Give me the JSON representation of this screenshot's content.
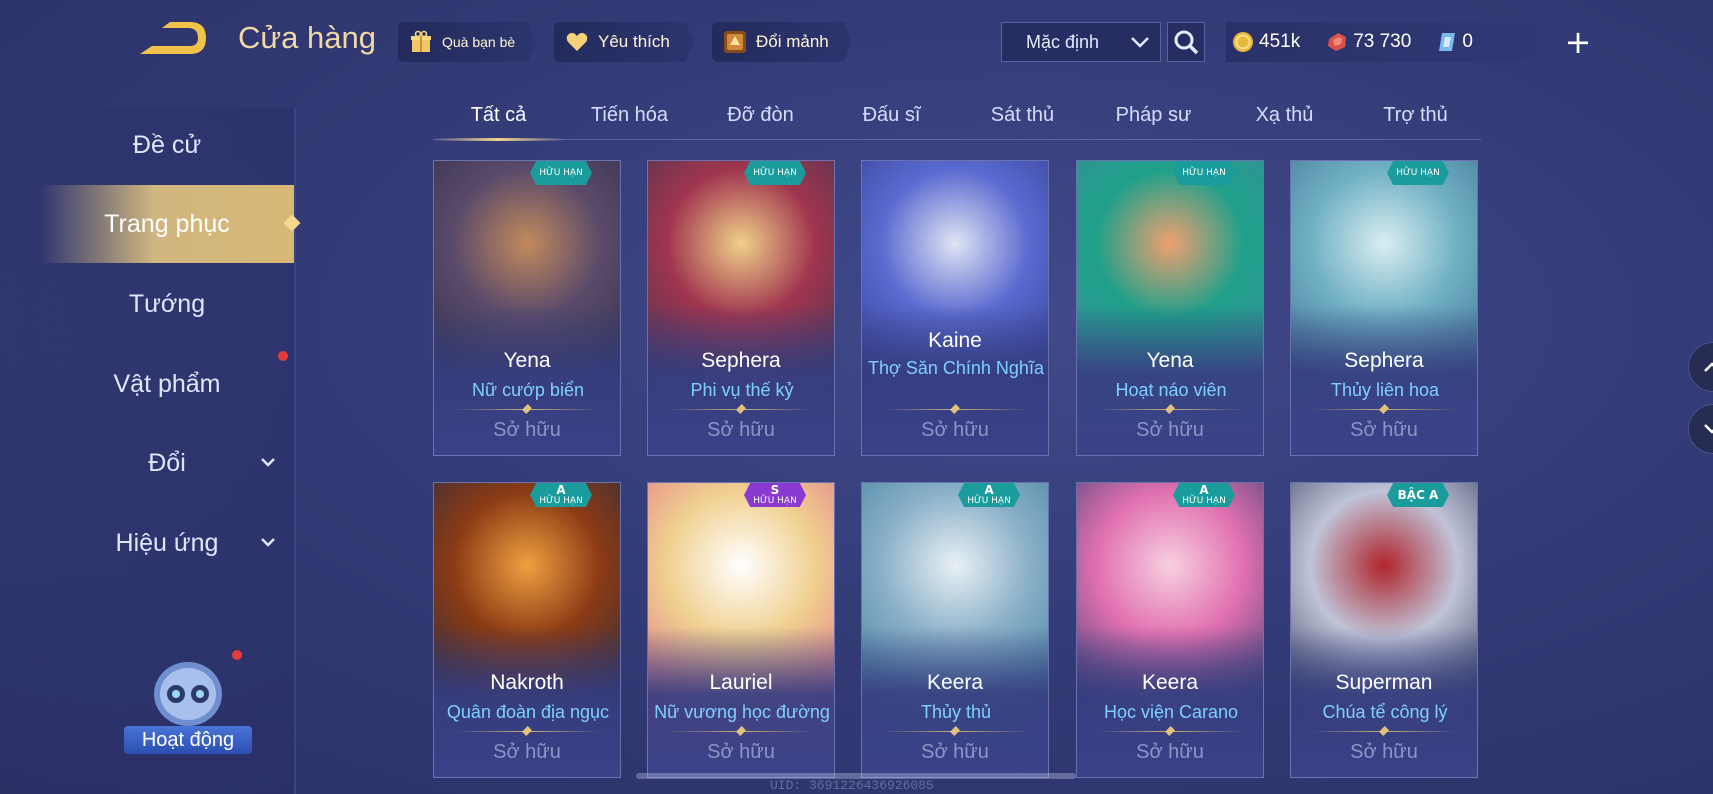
{
  "topbar": {
    "title": "Cửa hàng",
    "chips": [
      {
        "label": "Quà bạn bè",
        "icon": "gift-icon"
      },
      {
        "label": "Yêu thích",
        "icon": "heart-icon"
      },
      {
        "label": "Đổi mảnh",
        "icon": "fragment-icon"
      }
    ],
    "sort": {
      "selected": "Mặc định"
    },
    "currency": {
      "gold": "451k",
      "vouchers": "73 730",
      "gems": "0"
    },
    "plus_label": "+"
  },
  "sidebar": {
    "items": [
      {
        "label": "Đề cử",
        "active": false
      },
      {
        "label": "Trang phục",
        "active": true
      },
      {
        "label": "Tướng",
        "active": false
      },
      {
        "label": "Vật phẩm",
        "active": false
      },
      {
        "label": "Đổi",
        "active": false
      },
      {
        "label": "Hiệu ứng",
        "active": false
      }
    ],
    "activity_label": "Hoạt động"
  },
  "tabs": [
    "Tất cả",
    "Tiến hóa",
    "Đỡ đòn",
    "Đấu sĩ",
    "Sát thủ",
    "Pháp sư",
    "Xạ thủ",
    "Trợ thủ"
  ],
  "active_tab": 0,
  "cards": [
    {
      "hero": "Yena",
      "skin": "Nữ cướp biển",
      "status": "Sở hữu",
      "badge_tier": "",
      "badge_label": "HỮU HẠN",
      "badge_color": "#1a9c9c",
      "art": [
        "#2a2c44",
        "#5a4a6a",
        "#c28a5c"
      ]
    },
    {
      "hero": "Sephera",
      "skin": "Phi vụ thế kỷ",
      "status": "Sở hữu",
      "badge_tier": "",
      "badge_label": "HỮU HẠN",
      "badge_color": "#1a9c9c",
      "art": [
        "#3a3454",
        "#a0354e",
        "#f0d08a"
      ]
    },
    {
      "hero": "Kaine",
      "skin": "Thợ Săn Chính Nghĩa",
      "status": "Sở hữu",
      "badge_tier": "",
      "badge_label": "",
      "badge_color": "",
      "art": [
        "#2c3a8a",
        "#5a6ad0",
        "#e0e4f4"
      ]
    },
    {
      "hero": "Yena",
      "skin": "Hoạt náo viên",
      "status": "Sở hữu",
      "badge_tier": "",
      "badge_label": "HỮU HẠN",
      "badge_color": "#1a9c9c",
      "art": [
        "#3c8c9c",
        "#1fa08a",
        "#f0a070"
      ]
    },
    {
      "hero": "Sephera",
      "skin": "Thủy liên hoa",
      "status": "Sở hữu",
      "badge_tier": "",
      "badge_label": "HỮU HẠN",
      "badge_color": "#1a9c9c",
      "art": [
        "#3a6a8a",
        "#70b0c4",
        "#d8eef0"
      ]
    },
    {
      "hero": "Nakroth",
      "skin": "Quân đoàn địa ngục",
      "status": "Sở hữu",
      "badge_tier": "A",
      "badge_label": "HỮU HẠN",
      "badge_color": "#1a9c9c",
      "art": [
        "#1c2a4a",
        "#8a3a14",
        "#f0a040"
      ]
    },
    {
      "hero": "Lauriel",
      "skin": "Nữ vương học đường",
      "status": "Sở hữu",
      "badge_tier": "S",
      "badge_label": "HỮU HẠN",
      "badge_color": "#8a3ad0",
      "art": [
        "#e06a8a",
        "#f0d090",
        "#ffffff"
      ]
    },
    {
      "hero": "Keera",
      "skin": "Thủy thủ",
      "status": "Sở hữu",
      "badge_tier": "A",
      "badge_label": "HỮU HẠN",
      "badge_color": "#1a9c9c",
      "art": [
        "#3a7a9a",
        "#8ab0c8",
        "#e8f0f4"
      ]
    },
    {
      "hero": "Keera",
      "skin": "Học viện Carano",
      "status": "Sở hữu",
      "badge_tier": "A",
      "badge_label": "HỮU HẠN",
      "badge_color": "#1a9c9c",
      "art": [
        "#2a3a6a",
        "#e070b0",
        "#f8d0e0"
      ]
    },
    {
      "hero": "Superman",
      "skin": "Chúa tể công lý",
      "status": "Sở hữu",
      "badge_tier": "BẬC A",
      "badge_label": "",
      "badge_color": "#1a9c9c",
      "art": [
        "#2a3050",
        "#c0c4d8",
        "#b0242c"
      ]
    }
  ],
  "uid_text": "UID: 3691226436926085"
}
